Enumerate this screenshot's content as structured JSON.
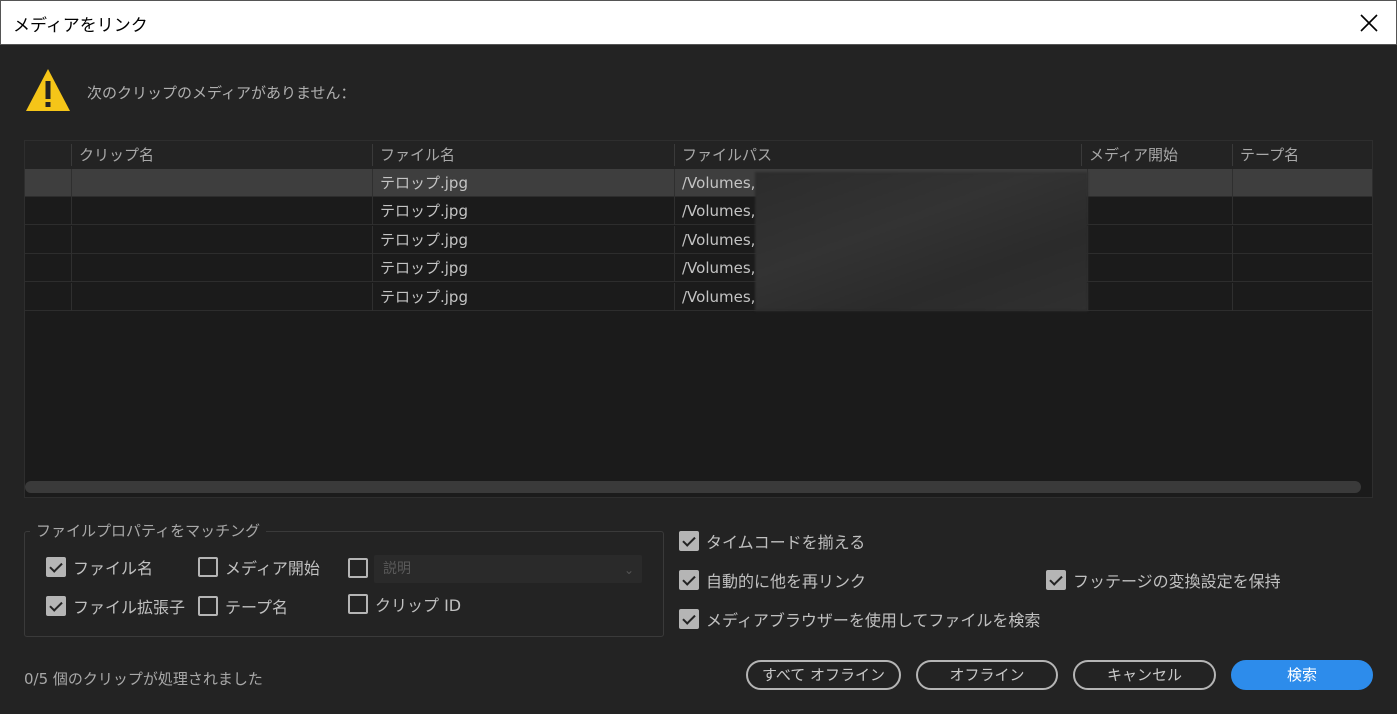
{
  "window": {
    "title": "メディアをリンク"
  },
  "warning": {
    "message": "次のクリップのメディアがありません："
  },
  "table": {
    "headers": [
      "クリップ名",
      "ファイル名",
      "ファイルパス",
      "メディア開始",
      "テープ名"
    ],
    "rows": [
      {
        "clip": "",
        "file": "テロップ.jpg",
        "path": "/Volumes,",
        "start": "",
        "tape": ""
      },
      {
        "clip": "",
        "file": "テロップ.jpg",
        "path": "/Volumes,",
        "start": "",
        "tape": ""
      },
      {
        "clip": "",
        "file": "テロップ.jpg",
        "path": "/Volumes,",
        "start": "",
        "tape": ""
      },
      {
        "clip": "",
        "file": "テロップ.jpg",
        "path": "/Volumes,",
        "start": "",
        "tape": ""
      },
      {
        "clip": "",
        "file": "テロップ.jpg",
        "path": "/Volumes,",
        "start": "",
        "tape": ""
      }
    ]
  },
  "match": {
    "title": "ファイルプロパティをマッチング",
    "filename": "ファイル名",
    "media_start": "メディア開始",
    "description_placeholder": "説明",
    "extension": "ファイル拡張子",
    "tape_name": "テープ名",
    "clip_id": "クリップ ID"
  },
  "options": {
    "align_timecode": "タイムコードを揃える",
    "auto_relink": "自動的に他を再リンク",
    "preserve_interpret": "フッテージの変換設定を保持",
    "use_media_browser": "メディアブラウザーを使用してファイルを検索"
  },
  "status": "0/5 個のクリップが処理されました",
  "buttons": {
    "offline_all": "すべて オフライン",
    "offline": "オフライン",
    "cancel": "キャンセル",
    "search": "検索"
  },
  "colors": {
    "accent": "#2d8ceb",
    "warning": "#f5c518"
  }
}
